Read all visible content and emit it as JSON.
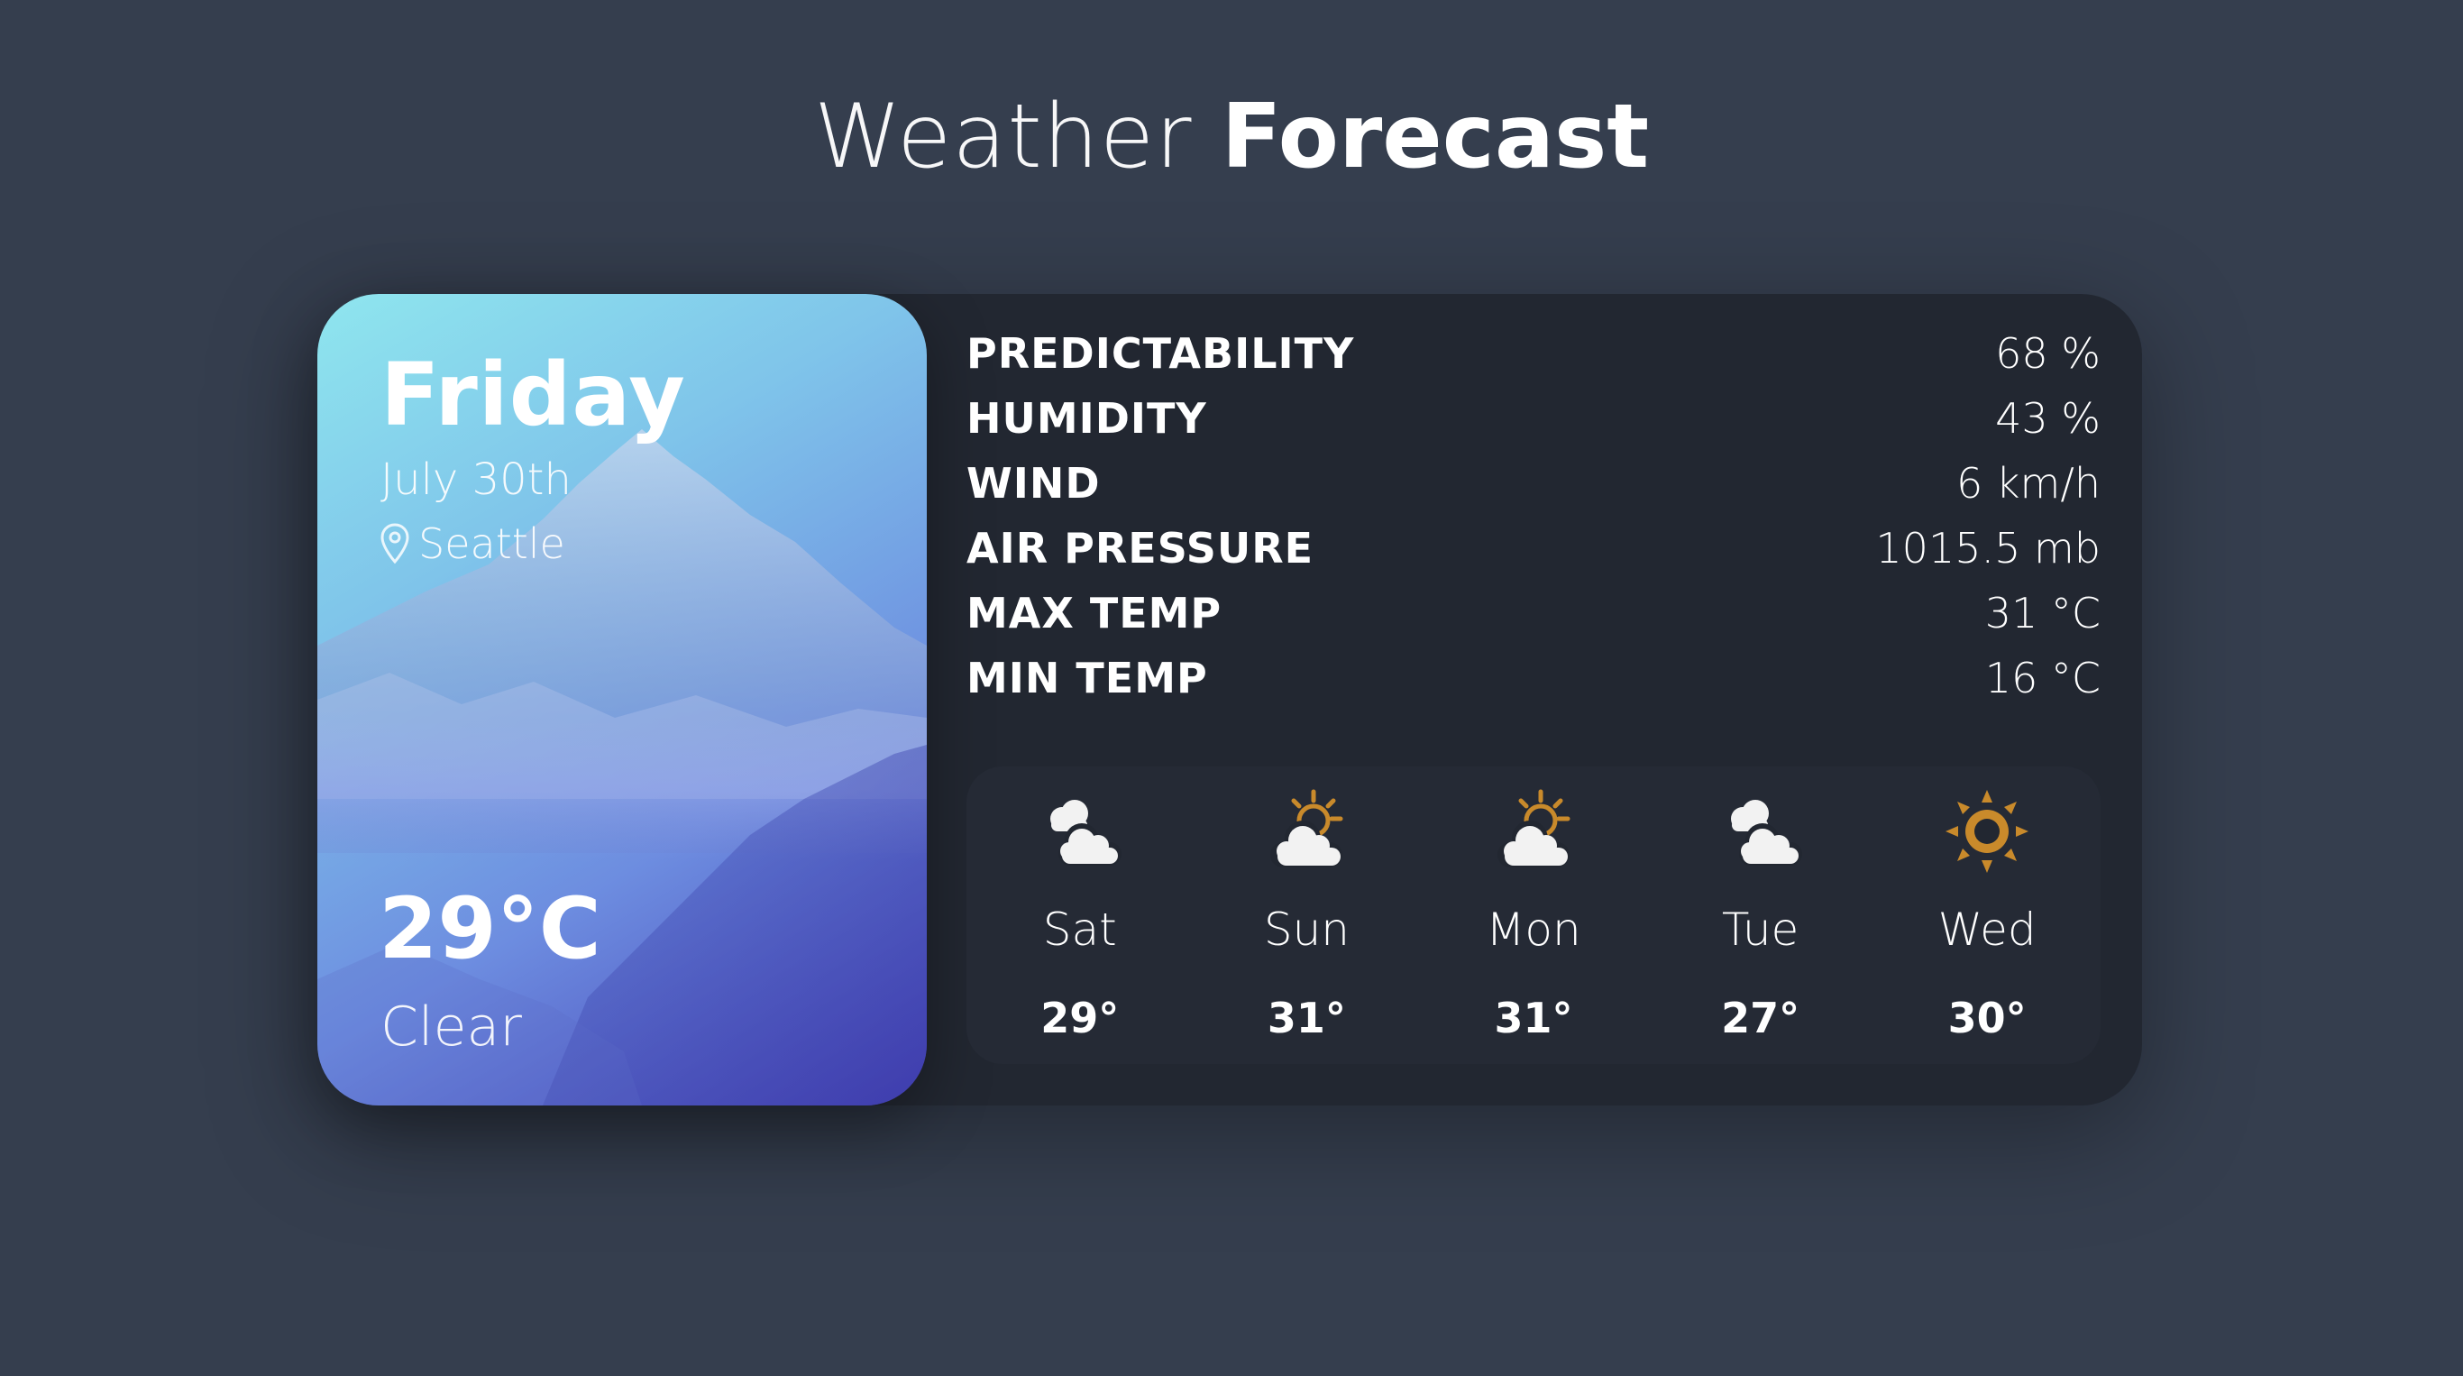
{
  "title": {
    "light": "Weather",
    "bold": "Forecast"
  },
  "current": {
    "day": "Friday",
    "date": "July 30th",
    "location": "Seattle",
    "temperature": "29°C",
    "condition": "Clear",
    "location_icon": "map-pin-icon"
  },
  "stats": [
    {
      "label": "PREDICTABILITY",
      "value": "68 %"
    },
    {
      "label": "HUMIDITY",
      "value": "43 %"
    },
    {
      "label": "WIND",
      "value": "6 km/h"
    },
    {
      "label": "AIR PRESSURE",
      "value": "1015.5 mb"
    },
    {
      "label": "MAX TEMP",
      "value": "31 °C"
    },
    {
      "label": "MIN TEMP",
      "value": "16 °C"
    }
  ],
  "forecast": [
    {
      "day": "Sat",
      "temp": "29°",
      "icon": "cloud-icon"
    },
    {
      "day": "Sun",
      "temp": "31°",
      "icon": "partly-sunny-icon"
    },
    {
      "day": "Mon",
      "temp": "31°",
      "icon": "partly-sunny-icon"
    },
    {
      "day": "Tue",
      "temp": "27°",
      "icon": "cloud-icon"
    },
    {
      "day": "Wed",
      "temp": "30°",
      "icon": "sun-icon"
    }
  ],
  "colors": {
    "background": "#353e4e",
    "card": "#222731",
    "sun": "#c98a2b",
    "cloud": "#f2f2f2"
  }
}
